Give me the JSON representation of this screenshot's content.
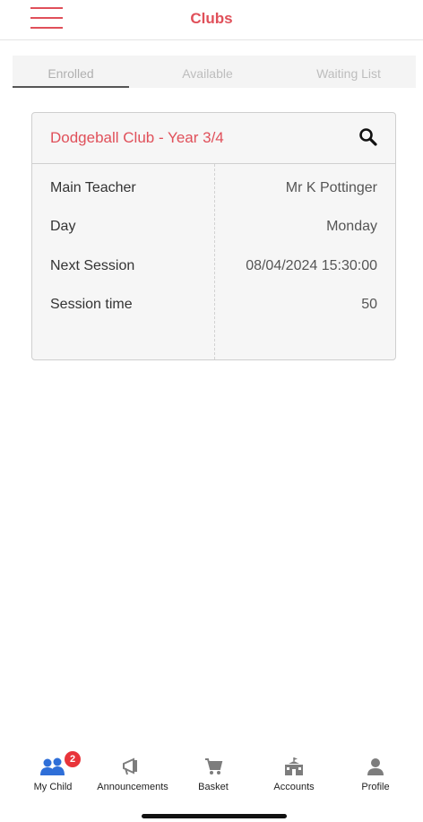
{
  "header": {
    "title": "Clubs",
    "menu_icon": "hamburger-menu-icon"
  },
  "tabs": [
    {
      "label": "Enrolled",
      "active": true
    },
    {
      "label": "Available",
      "active": false
    },
    {
      "label": "Waiting List",
      "active": false
    }
  ],
  "club": {
    "title": "Dodgeball Club - Year 3/4",
    "search_icon": "search-icon",
    "rows": [
      {
        "label": "Main Teacher",
        "value": "Mr K Pottinger"
      },
      {
        "label": "Day",
        "value": "Monday"
      },
      {
        "label": "Next Session",
        "value": "08/04/2024 15:30:00"
      },
      {
        "label": "Session time",
        "value": "50"
      }
    ]
  },
  "nav": {
    "items": [
      {
        "label": "My Child",
        "icon": "children-icon",
        "badge": "2",
        "active": true
      },
      {
        "label": "Announcements",
        "icon": "megaphone-icon"
      },
      {
        "label": "Basket",
        "icon": "cart-icon"
      },
      {
        "label": "Accounts",
        "icon": "school-building-icon"
      },
      {
        "label": "Profile",
        "icon": "profile-icon"
      }
    ]
  },
  "colors": {
    "accent": "#e0505a",
    "nav_active": "#2f6fd8",
    "badge": "#e8343a",
    "nav_inactive": "#7d7d7d"
  }
}
